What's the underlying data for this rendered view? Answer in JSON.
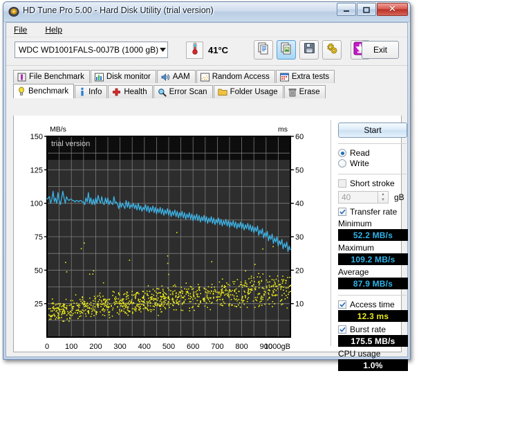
{
  "window": {
    "title": "HD Tune Pro 5.00 - Hard Disk Utility (trial version)",
    "icon": "hdtune-icon",
    "buttons": {
      "minimize": "minimize-icon",
      "maximize": "maximize-icon",
      "close": "close-icon"
    }
  },
  "menu": {
    "items": [
      "File",
      "Help"
    ]
  },
  "toolbar": {
    "device": "WDC WD1001FALS-00J7B    (1000 gB)",
    "device_arrow": "chevron-down-icon",
    "temperature": "41°C",
    "temperature_icon": "thermometer-icon",
    "buttons": [
      {
        "name": "copy-text-button",
        "icon": "copy-text-icon",
        "selected": false
      },
      {
        "name": "copy-image-button",
        "icon": "copy-image-icon",
        "selected": true
      },
      {
        "name": "save-button",
        "icon": "floppy-disk-icon",
        "selected": false
      },
      {
        "name": "settings-button",
        "icon": "gears-icon",
        "selected": false
      },
      {
        "name": "download-button",
        "icon": "download-arrow-icon",
        "selected": false
      }
    ],
    "exit_label": "Exit"
  },
  "tabs_top": [
    {
      "label": "File Benchmark",
      "icon": "file-benchmark-icon"
    },
    {
      "label": "Disk monitor",
      "icon": "bar-chart-icon"
    },
    {
      "label": "AAM",
      "icon": "speaker-icon"
    },
    {
      "label": "Random Access",
      "icon": "scatter-icon"
    },
    {
      "label": "Extra tests",
      "icon": "extra-tests-icon"
    }
  ],
  "tabs_main": [
    {
      "label": "Benchmark",
      "icon": "bulb-icon",
      "active": true
    },
    {
      "label": "Info",
      "icon": "info-icon",
      "active": false
    },
    {
      "label": "Health",
      "icon": "health-cross-icon",
      "active": false
    },
    {
      "label": "Error Scan",
      "icon": "magnifier-icon",
      "active": false
    },
    {
      "label": "Folder Usage",
      "icon": "folder-icon",
      "active": false
    },
    {
      "label": "Erase",
      "icon": "trash-icon",
      "active": false
    }
  ],
  "panel": {
    "start_label": "Start",
    "mode": {
      "read_label": "Read",
      "write_label": "Write",
      "selected": "Read"
    },
    "short_stroke": {
      "label": "Short stroke",
      "checked": false,
      "value": "40",
      "unit": "gB"
    },
    "transfer_rate": {
      "label": "Transfer rate",
      "checked": true,
      "minimum_label": "Minimum",
      "minimum_value": "52.2 MB/s",
      "maximum_label": "Maximum",
      "maximum_value": "109.2 MB/s",
      "average_label": "Average",
      "average_value": "87.9 MB/s"
    },
    "access_time": {
      "label": "Access time",
      "checked": true,
      "value": "12.3 ms"
    },
    "burst_rate": {
      "label": "Burst rate",
      "checked": true,
      "value": "175.5 MB/s"
    },
    "cpu_usage": {
      "label": "CPU usage",
      "value": "1.0%"
    }
  },
  "chart_data": {
    "type": "line",
    "title": "",
    "watermark": "trial version",
    "xlabel": "gB",
    "ylabel": "MB/s",
    "y2label": "ms",
    "xlim": [
      0,
      1000
    ],
    "ylim": [
      0,
      150
    ],
    "y2lim": [
      0,
      60
    ],
    "xticks": [
      0,
      100,
      200,
      300,
      400,
      500,
      600,
      700,
      800,
      900,
      1000
    ],
    "xticklabels": [
      "0",
      "100",
      "200",
      "300",
      "400",
      "500",
      "600",
      "700",
      "800",
      "900",
      "1000gB"
    ],
    "yticks": [
      25,
      50,
      75,
      100,
      125,
      150
    ],
    "y2ticks": [
      10,
      20,
      30,
      40,
      50,
      60
    ],
    "grid": true,
    "colors": {
      "transfer_rate": "#3cb4e8",
      "access_time": "#f2f018",
      "background": "#2d2d2d",
      "grid": "#8c8c8c",
      "top_band": "#0d0d0d"
    },
    "legend": [],
    "series": [
      {
        "name": "Transfer rate",
        "type": "line",
        "axis": "left",
        "unit": "MB/s",
        "color": "#3cb4e8",
        "x": [
          0,
          5,
          10,
          15,
          20,
          25,
          30,
          35,
          40,
          45,
          50,
          55,
          60,
          65,
          70,
          75,
          80,
          85,
          90,
          95,
          100,
          105,
          110,
          115,
          120,
          125,
          130,
          135,
          140,
          145,
          150,
          155,
          160,
          165,
          170,
          175,
          180,
          185,
          190,
          195,
          200,
          205,
          210,
          215,
          220,
          225,
          230,
          235,
          240,
          245,
          250,
          255,
          260,
          265,
          270,
          275,
          280,
          285,
          290,
          295,
          300,
          305,
          310,
          315,
          320,
          325,
          330,
          335,
          340,
          345,
          350,
          355,
          360,
          365,
          370,
          375,
          380,
          385,
          390,
          395,
          400,
          405,
          410,
          415,
          420,
          425,
          430,
          435,
          440,
          445,
          450,
          455,
          460,
          465,
          470,
          475,
          480,
          485,
          490,
          495,
          500,
          505,
          510,
          515,
          520,
          525,
          530,
          535,
          540,
          545,
          550,
          555,
          560,
          565,
          570,
          575,
          580,
          585,
          590,
          595,
          600,
          605,
          610,
          615,
          620,
          625,
          630,
          635,
          640,
          645,
          650,
          655,
          660,
          665,
          670,
          675,
          680,
          685,
          690,
          695,
          700,
          705,
          710,
          715,
          720,
          725,
          730,
          735,
          740,
          745,
          750,
          755,
          760,
          765,
          770,
          775,
          780,
          785,
          790,
          795,
          800,
          805,
          810,
          815,
          820,
          825,
          830,
          835,
          840,
          845,
          850,
          855,
          860,
          865,
          870,
          875,
          880,
          885,
          890,
          895,
          900,
          905,
          910,
          915,
          920,
          925,
          930,
          935,
          940,
          945,
          950,
          955,
          960,
          965,
          970,
          975,
          980,
          985,
          990,
          995,
          1000
        ],
        "y": [
          103,
          104,
          105,
          100,
          103,
          109,
          101,
          104,
          100,
          108,
          102,
          99,
          104,
          109,
          104,
          100,
          105,
          103,
          102,
          103,
          103,
          102,
          102,
          101,
          102,
          102,
          101,
          102,
          102,
          101,
          101,
          99,
          104,
          101,
          108,
          100,
          104,
          99,
          103,
          99,
          104,
          100,
          106,
          102,
          100,
          105,
          100,
          99,
          104,
          100,
          104,
          99,
          102,
          100,
          99,
          105,
          100,
          101,
          99,
          96,
          101,
          97,
          100,
          98,
          96,
          102,
          97,
          101,
          96,
          99,
          97,
          100,
          96,
          99,
          95,
          100,
          95,
          98,
          94,
          97,
          95,
          99,
          94,
          98,
          93,
          97,
          94,
          98,
          93,
          97,
          92,
          96,
          93,
          97,
          92,
          96,
          91,
          95,
          92,
          96,
          91,
          95,
          90,
          94,
          91,
          95,
          90,
          94,
          89,
          93,
          90,
          94,
          89,
          93,
          88,
          92,
          89,
          93,
          88,
          92,
          87,
          91,
          88,
          92,
          87,
          91,
          86,
          90,
          87,
          91,
          86,
          90,
          85,
          89,
          86,
          90,
          85,
          89,
          84,
          88,
          85,
          89,
          84,
          88,
          83,
          87,
          84,
          88,
          83,
          87,
          82,
          86,
          83,
          87,
          82,
          86,
          81,
          85,
          82,
          86,
          81,
          85,
          80,
          84,
          81,
          85,
          80,
          84,
          79,
          83,
          78,
          82,
          79,
          83,
          76,
          80,
          77,
          81,
          74,
          78,
          75,
          79,
          72,
          76,
          73,
          77,
          70,
          74,
          71,
          75,
          68,
          72,
          69,
          73,
          66,
          70,
          67,
          71,
          64,
          68,
          65,
          69,
          62,
          66,
          63,
          67,
          60,
          64,
          61,
          65,
          58,
          62,
          59,
          63,
          57
        ]
      },
      {
        "name": "Access time",
        "type": "scatter",
        "axis": "right",
        "unit": "ms",
        "color": "#f2f018",
        "description": "dense scatter cloud of access-time samples, rising from roughly 4-12 ms near 0 gB to roughly 8-22 ms near 1000 gB, average 12.3 ms",
        "average": 12.3,
        "range_start": [
          3.5,
          12.5
        ],
        "range_end": [
          8.0,
          22.0
        ],
        "point_count": 1100
      }
    ]
  }
}
